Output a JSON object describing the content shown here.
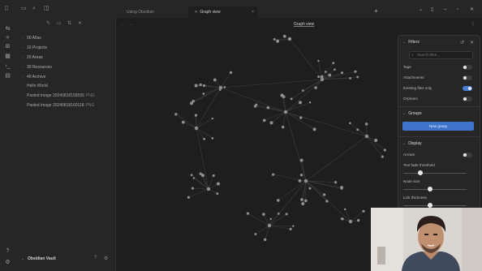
{
  "sidebar": {
    "folders": [
      {
        "label": "00 Atlas"
      },
      {
        "label": "10 Projects"
      },
      {
        "label": "20 Areas"
      },
      {
        "label": "30 Resources"
      },
      {
        "label": "40 Archive"
      }
    ],
    "files": [
      {
        "label": "Hello World",
        "ext": ""
      },
      {
        "label": "Pasted image 20240818155555",
        "ext": "PNG"
      },
      {
        "label": "Pasted image 20240818160118",
        "ext": "PNG"
      }
    ],
    "vault_name": "Obsidian Vault"
  },
  "tabs": [
    {
      "label": "Using Obsidian",
      "active": false
    },
    {
      "label": "Graph view",
      "active": true
    }
  ],
  "view": {
    "title": "Graph view"
  },
  "filters": {
    "header": "Filters",
    "search_placeholder": "Search files...",
    "toggles": [
      {
        "label": "Tags",
        "on": false
      },
      {
        "label": "Attachments",
        "on": false
      },
      {
        "label": "Existing files only",
        "on": true
      },
      {
        "label": "Orphans",
        "on": false
      }
    ]
  },
  "groups": {
    "header": "Groups",
    "new_group_label": "New group"
  },
  "display": {
    "header": "Display",
    "arrows": {
      "label": "Arrows",
      "on": false
    },
    "sliders": [
      {
        "label": "Text fade threshold",
        "value": 0.27
      },
      {
        "label": "Node size",
        "value": 0.42
      },
      {
        "label": "Link thickness",
        "value": 0.42
      }
    ]
  },
  "colors": {
    "accent": "#4a7fd6",
    "node": "#8f8f8f",
    "link": "#3d3d3d",
    "background": "#1e1e1e"
  }
}
